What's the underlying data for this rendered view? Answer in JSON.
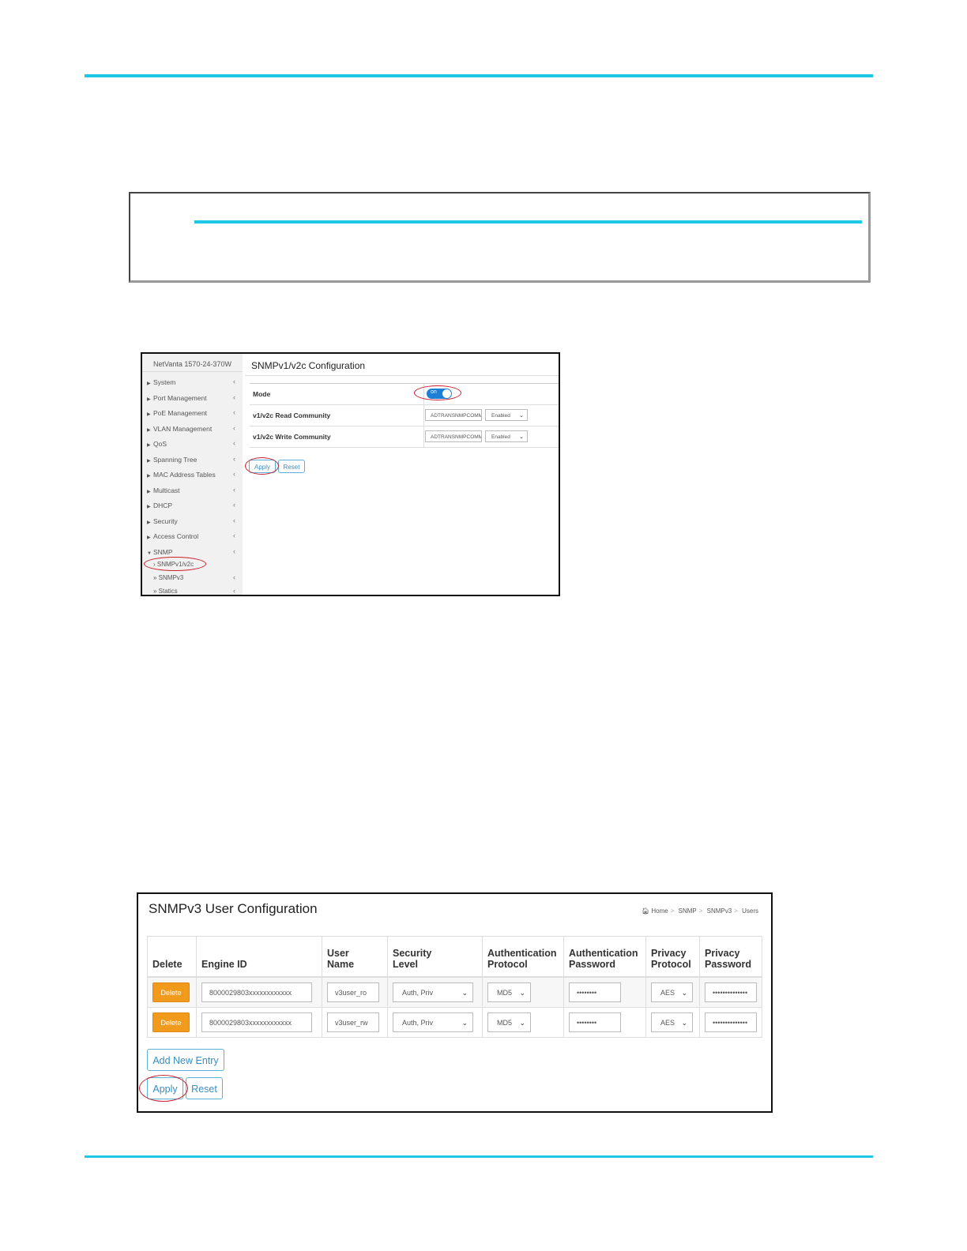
{
  "snmpv12c": {
    "brand": "NetVanta 1570-24-370W",
    "title": "SNMPv1/v2c Configuration",
    "nav": [
      "System",
      "Port Management",
      "PoE Management",
      "VLAN Management",
      "QoS",
      "Spanning Tree",
      "MAC Address Tables",
      "Multicast",
      "DHCP",
      "Security",
      "Access Control",
      "SNMP"
    ],
    "subnav": [
      "SNMPv1/v2c",
      "SNMPv3",
      "Statics"
    ],
    "mode_label": "Mode",
    "mode_toggle": "on",
    "read_label": "v1/v2c Read Community",
    "read_value": "ADTRANSNMPCOMM",
    "read_state": "Enabled",
    "write_label": "v1/v2c Write Community",
    "write_value": "ADTRANSNMPCOMM",
    "write_state": "Enabled",
    "apply": "Apply",
    "reset": "Reset"
  },
  "snmpv3": {
    "title": "SNMPv3 User Configuration",
    "breadcrumb": [
      "Home",
      "SNMP",
      "SNMPv3",
      "Users"
    ],
    "headers": [
      [
        "Delete"
      ],
      [
        "Engine ID"
      ],
      [
        "User",
        "Name"
      ],
      [
        "Security",
        "Level"
      ],
      [
        "Authentication",
        "Protocol"
      ],
      [
        "Authentication",
        "Password"
      ],
      [
        "Privacy",
        "Protocol"
      ],
      [
        "Privacy",
        "Password"
      ]
    ],
    "rows": [
      {
        "delete": "Delete",
        "engine_id": "8000029803xxxxxxxxxxxx",
        "user": "v3user_ro",
        "security": "Auth, Priv",
        "auth_proto": "MD5",
        "auth_pass": "••••••••",
        "priv_proto": "AES",
        "priv_pass": "••••••••••••••"
      },
      {
        "delete": "Delete",
        "engine_id": "8000029803xxxxxxxxxxxx",
        "user": "v3user_rw",
        "security": "Auth, Priv",
        "auth_proto": "MD5",
        "auth_pass": "••••••••",
        "priv_proto": "AES",
        "priv_pass": "••••••••••••••"
      }
    ],
    "add_new": "Add New Entry",
    "apply": "Apply",
    "reset": "Reset"
  },
  "colors": {
    "accent": "#1ec8e4",
    "highlight": "#cc1f2a",
    "delete": "#f29a1c",
    "button": "#3a8fc0"
  }
}
